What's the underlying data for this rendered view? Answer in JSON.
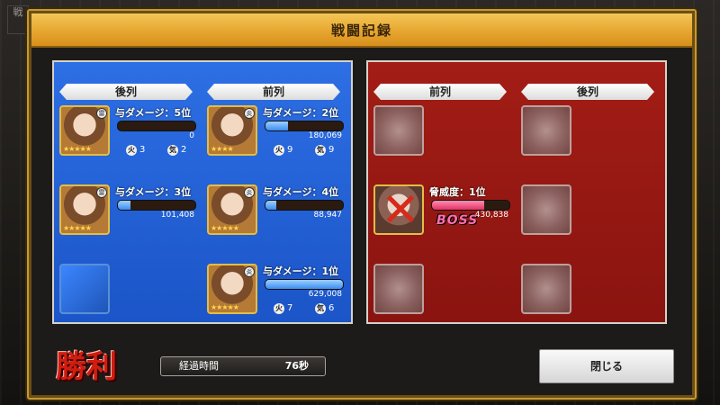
{
  "window": {
    "title": "戦闘記録"
  },
  "corner_icon": "戦",
  "ally": {
    "headers": [
      "後列",
      "前列"
    ],
    "units": [
      {
        "dmg_label": "与ダメージ：5位",
        "damage": "0",
        "fill": 0.0,
        "fire": "3",
        "ki": "2",
        "element": "雷",
        "stars": "★★★★★"
      },
      {
        "dmg_label": "与ダメージ：3位",
        "damage": "101,408",
        "fill": 0.16,
        "element": "雷",
        "stars": "★★★★★"
      },
      {
        "dmg_label": "与ダメージ：2位",
        "damage": "180,069",
        "fill": 0.29,
        "fire": "9",
        "ki": "9",
        "element": "炎",
        "stars": "★★★★"
      },
      {
        "dmg_label": "与ダメージ：4位",
        "damage": "88,947",
        "fill": 0.14,
        "element": "炎",
        "stars": "★★★★★"
      },
      {
        "dmg_label": "与ダメージ：1位",
        "damage": "629,008",
        "fill": 1.0,
        "fire": "7",
        "ki": "6",
        "element": "炎",
        "stars": "★★★★★"
      }
    ]
  },
  "enemy": {
    "headers": [
      "前列",
      "後列"
    ],
    "boss": {
      "threat_label": "脅威度：1位",
      "damage": "430,838",
      "fill": 0.68,
      "tag": "BOSS"
    }
  },
  "stat_icons": {
    "fire": "火",
    "ki": "気"
  },
  "footer": {
    "victory": "勝利",
    "elapsed_label": "経過時間",
    "elapsed_value": "76秒",
    "close_label": "閉じる"
  }
}
